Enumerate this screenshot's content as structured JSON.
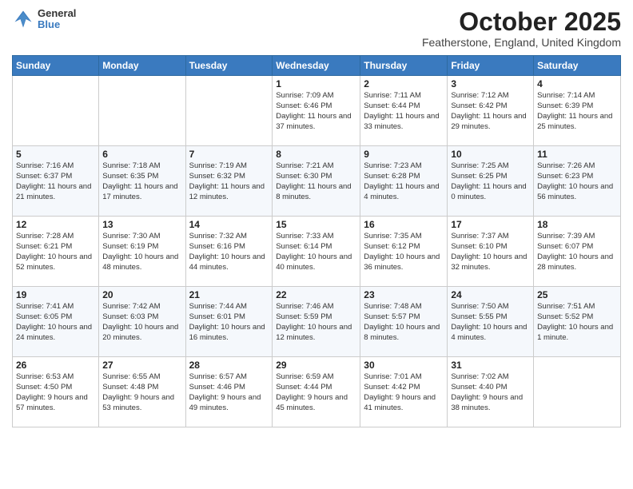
{
  "header": {
    "logo_general": "General",
    "logo_blue": "Blue",
    "month_title": "October 2025",
    "location": "Featherstone, England, United Kingdom"
  },
  "days_of_week": [
    "Sunday",
    "Monday",
    "Tuesday",
    "Wednesday",
    "Thursday",
    "Friday",
    "Saturday"
  ],
  "weeks": [
    [
      {
        "day": "",
        "sunrise": "",
        "sunset": "",
        "daylight": ""
      },
      {
        "day": "",
        "sunrise": "",
        "sunset": "",
        "daylight": ""
      },
      {
        "day": "",
        "sunrise": "",
        "sunset": "",
        "daylight": ""
      },
      {
        "day": "1",
        "sunrise": "Sunrise: 7:09 AM",
        "sunset": "Sunset: 6:46 PM",
        "daylight": "Daylight: 11 hours and 37 minutes."
      },
      {
        "day": "2",
        "sunrise": "Sunrise: 7:11 AM",
        "sunset": "Sunset: 6:44 PM",
        "daylight": "Daylight: 11 hours and 33 minutes."
      },
      {
        "day": "3",
        "sunrise": "Sunrise: 7:12 AM",
        "sunset": "Sunset: 6:42 PM",
        "daylight": "Daylight: 11 hours and 29 minutes."
      },
      {
        "day": "4",
        "sunrise": "Sunrise: 7:14 AM",
        "sunset": "Sunset: 6:39 PM",
        "daylight": "Daylight: 11 hours and 25 minutes."
      }
    ],
    [
      {
        "day": "5",
        "sunrise": "Sunrise: 7:16 AM",
        "sunset": "Sunset: 6:37 PM",
        "daylight": "Daylight: 11 hours and 21 minutes."
      },
      {
        "day": "6",
        "sunrise": "Sunrise: 7:18 AM",
        "sunset": "Sunset: 6:35 PM",
        "daylight": "Daylight: 11 hours and 17 minutes."
      },
      {
        "day": "7",
        "sunrise": "Sunrise: 7:19 AM",
        "sunset": "Sunset: 6:32 PM",
        "daylight": "Daylight: 11 hours and 12 minutes."
      },
      {
        "day": "8",
        "sunrise": "Sunrise: 7:21 AM",
        "sunset": "Sunset: 6:30 PM",
        "daylight": "Daylight: 11 hours and 8 minutes."
      },
      {
        "day": "9",
        "sunrise": "Sunrise: 7:23 AM",
        "sunset": "Sunset: 6:28 PM",
        "daylight": "Daylight: 11 hours and 4 minutes."
      },
      {
        "day": "10",
        "sunrise": "Sunrise: 7:25 AM",
        "sunset": "Sunset: 6:25 PM",
        "daylight": "Daylight: 11 hours and 0 minutes."
      },
      {
        "day": "11",
        "sunrise": "Sunrise: 7:26 AM",
        "sunset": "Sunset: 6:23 PM",
        "daylight": "Daylight: 10 hours and 56 minutes."
      }
    ],
    [
      {
        "day": "12",
        "sunrise": "Sunrise: 7:28 AM",
        "sunset": "Sunset: 6:21 PM",
        "daylight": "Daylight: 10 hours and 52 minutes."
      },
      {
        "day": "13",
        "sunrise": "Sunrise: 7:30 AM",
        "sunset": "Sunset: 6:19 PM",
        "daylight": "Daylight: 10 hours and 48 minutes."
      },
      {
        "day": "14",
        "sunrise": "Sunrise: 7:32 AM",
        "sunset": "Sunset: 6:16 PM",
        "daylight": "Daylight: 10 hours and 44 minutes."
      },
      {
        "day": "15",
        "sunrise": "Sunrise: 7:33 AM",
        "sunset": "Sunset: 6:14 PM",
        "daylight": "Daylight: 10 hours and 40 minutes."
      },
      {
        "day": "16",
        "sunrise": "Sunrise: 7:35 AM",
        "sunset": "Sunset: 6:12 PM",
        "daylight": "Daylight: 10 hours and 36 minutes."
      },
      {
        "day": "17",
        "sunrise": "Sunrise: 7:37 AM",
        "sunset": "Sunset: 6:10 PM",
        "daylight": "Daylight: 10 hours and 32 minutes."
      },
      {
        "day": "18",
        "sunrise": "Sunrise: 7:39 AM",
        "sunset": "Sunset: 6:07 PM",
        "daylight": "Daylight: 10 hours and 28 minutes."
      }
    ],
    [
      {
        "day": "19",
        "sunrise": "Sunrise: 7:41 AM",
        "sunset": "Sunset: 6:05 PM",
        "daylight": "Daylight: 10 hours and 24 minutes."
      },
      {
        "day": "20",
        "sunrise": "Sunrise: 7:42 AM",
        "sunset": "Sunset: 6:03 PM",
        "daylight": "Daylight: 10 hours and 20 minutes."
      },
      {
        "day": "21",
        "sunrise": "Sunrise: 7:44 AM",
        "sunset": "Sunset: 6:01 PM",
        "daylight": "Daylight: 10 hours and 16 minutes."
      },
      {
        "day": "22",
        "sunrise": "Sunrise: 7:46 AM",
        "sunset": "Sunset: 5:59 PM",
        "daylight": "Daylight: 10 hours and 12 minutes."
      },
      {
        "day": "23",
        "sunrise": "Sunrise: 7:48 AM",
        "sunset": "Sunset: 5:57 PM",
        "daylight": "Daylight: 10 hours and 8 minutes."
      },
      {
        "day": "24",
        "sunrise": "Sunrise: 7:50 AM",
        "sunset": "Sunset: 5:55 PM",
        "daylight": "Daylight: 10 hours and 4 minutes."
      },
      {
        "day": "25",
        "sunrise": "Sunrise: 7:51 AM",
        "sunset": "Sunset: 5:52 PM",
        "daylight": "Daylight: 10 hours and 1 minute."
      }
    ],
    [
      {
        "day": "26",
        "sunrise": "Sunrise: 6:53 AM",
        "sunset": "Sunset: 4:50 PM",
        "daylight": "Daylight: 9 hours and 57 minutes."
      },
      {
        "day": "27",
        "sunrise": "Sunrise: 6:55 AM",
        "sunset": "Sunset: 4:48 PM",
        "daylight": "Daylight: 9 hours and 53 minutes."
      },
      {
        "day": "28",
        "sunrise": "Sunrise: 6:57 AM",
        "sunset": "Sunset: 4:46 PM",
        "daylight": "Daylight: 9 hours and 49 minutes."
      },
      {
        "day": "29",
        "sunrise": "Sunrise: 6:59 AM",
        "sunset": "Sunset: 4:44 PM",
        "daylight": "Daylight: 9 hours and 45 minutes."
      },
      {
        "day": "30",
        "sunrise": "Sunrise: 7:01 AM",
        "sunset": "Sunset: 4:42 PM",
        "daylight": "Daylight: 9 hours and 41 minutes."
      },
      {
        "day": "31",
        "sunrise": "Sunrise: 7:02 AM",
        "sunset": "Sunset: 4:40 PM",
        "daylight": "Daylight: 9 hours and 38 minutes."
      },
      {
        "day": "",
        "sunrise": "",
        "sunset": "",
        "daylight": ""
      }
    ]
  ]
}
